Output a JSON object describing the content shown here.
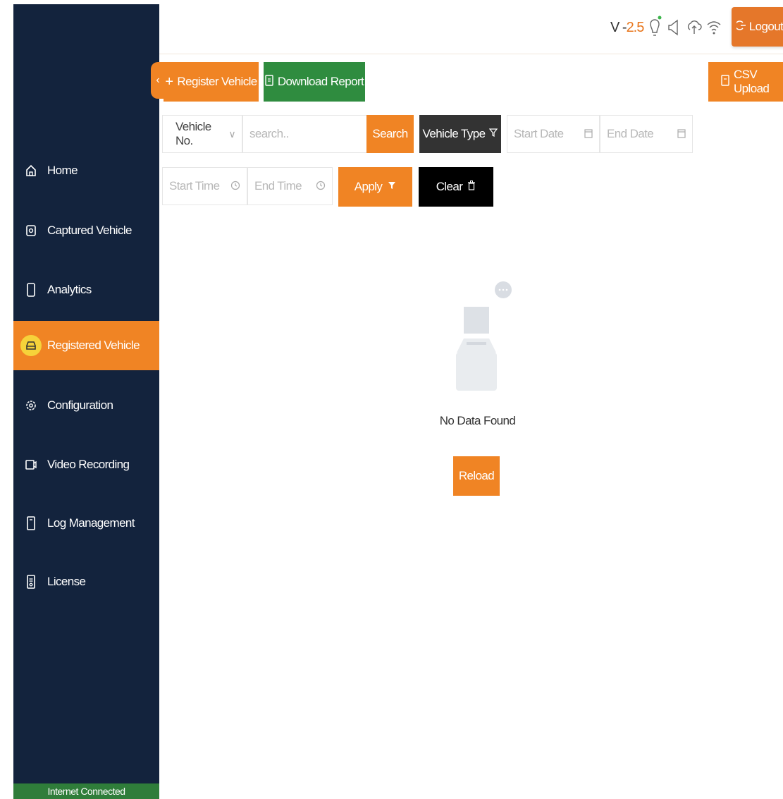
{
  "header": {
    "version_prefix": "V -",
    "version_number": "2.5",
    "logout_label": "Logout"
  },
  "sidebar": {
    "items": [
      {
        "label": "Home",
        "icon": "home-icon"
      },
      {
        "label": "Captured Vehicle",
        "icon": "camera-icon"
      },
      {
        "label": "Analytics",
        "icon": "phone-icon"
      },
      {
        "label": "Registered Vehicle",
        "icon": "car-icon",
        "active": true
      },
      {
        "label": "Configuration",
        "icon": "gear-icon"
      },
      {
        "label": "Video Recording",
        "icon": "video-icon"
      },
      {
        "label": "Log Management",
        "icon": "log-icon"
      },
      {
        "label": "License",
        "icon": "license-icon"
      }
    ],
    "status": "Internet Connected"
  },
  "toolbar": {
    "register_label": "Register Vehicle",
    "download_label": "Download Report",
    "csv_label": "CSV Upload"
  },
  "filters": {
    "search_field": "Vehicle No.",
    "search_placeholder": "search..",
    "search_button": "Search",
    "vehicle_type": "Vehicle Type",
    "start_date": "Start Date",
    "end_date": "End Date",
    "start_time": "Start Time",
    "end_time": "End Time",
    "apply_label": "Apply",
    "clear_label": "Clear"
  },
  "empty_state": {
    "message": "No Data Found",
    "reload_label": "Reload"
  },
  "colors": {
    "accent": "#f08424",
    "sidebar": "#13233d",
    "success": "#2f8c3f",
    "status": "#2f7d3a"
  }
}
